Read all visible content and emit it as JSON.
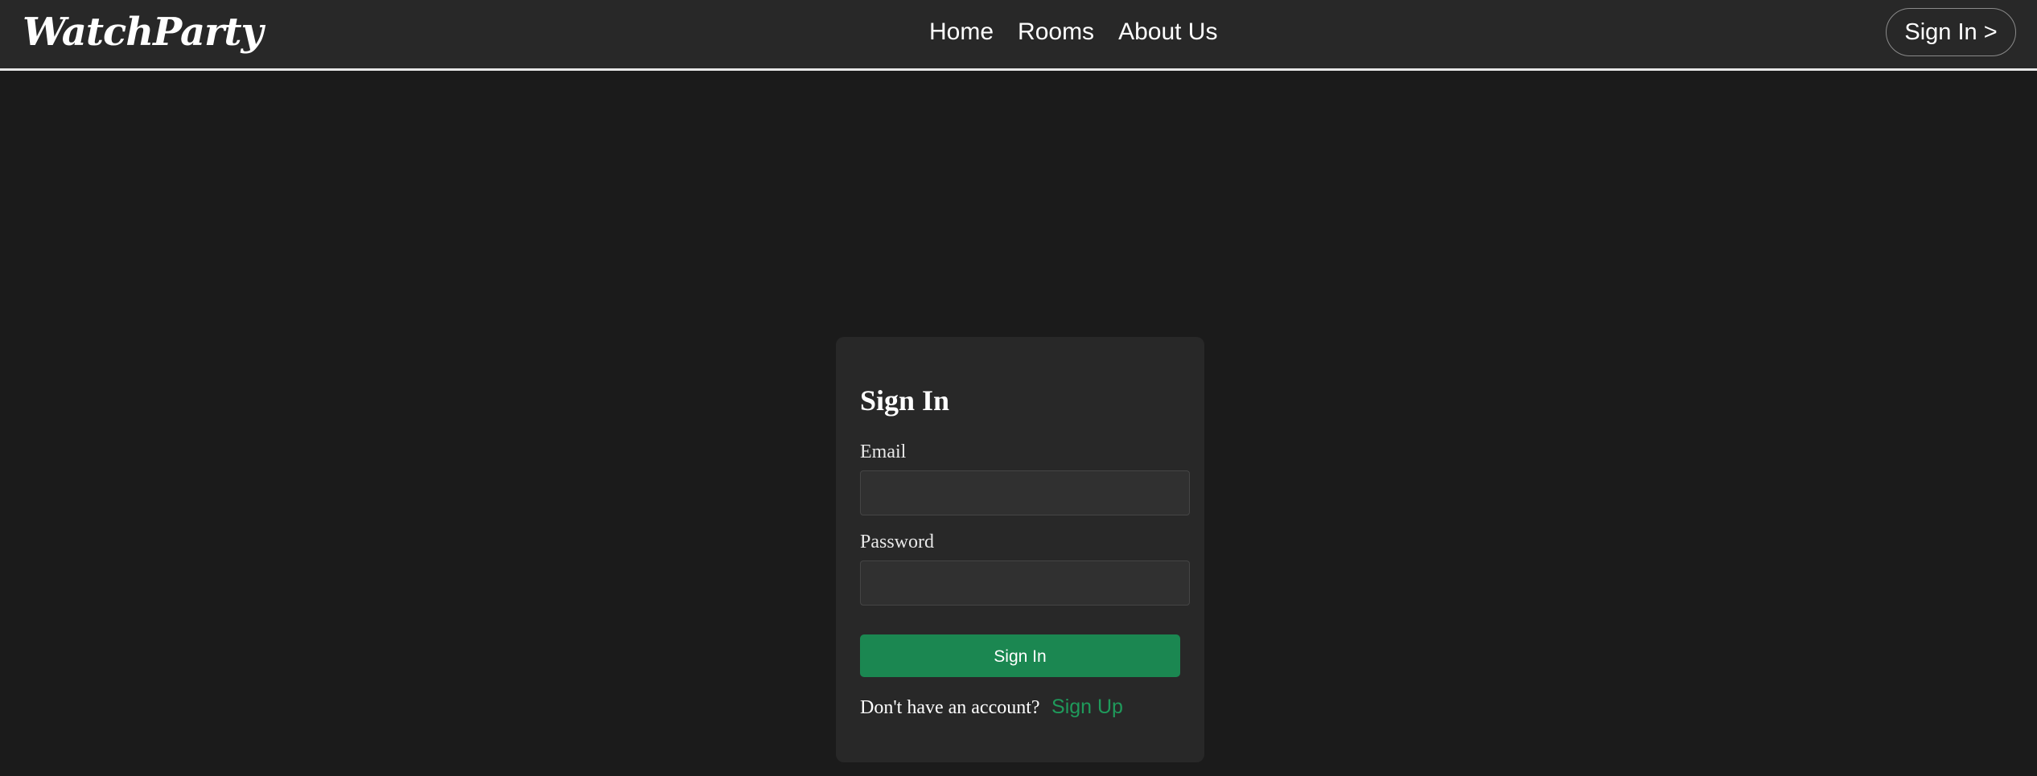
{
  "navbar": {
    "brand": "WatchParty",
    "links": [
      {
        "label": "Home"
      },
      {
        "label": "Rooms"
      },
      {
        "label": "About Us"
      }
    ],
    "sign_in_button": "Sign In >"
  },
  "signin_form": {
    "title": "Sign In",
    "email_label": "Email",
    "email_value": "",
    "password_label": "Password",
    "password_value": "",
    "submit_label": "Sign In",
    "account_prompt": "Don't have an account?",
    "signup_link": "Sign Up"
  },
  "colors": {
    "page_background": "#1b1b1b",
    "navbar_background": "#282828",
    "card_background": "#282828",
    "accent_green": "#1b8751",
    "link_green": "#1f9a5b"
  }
}
